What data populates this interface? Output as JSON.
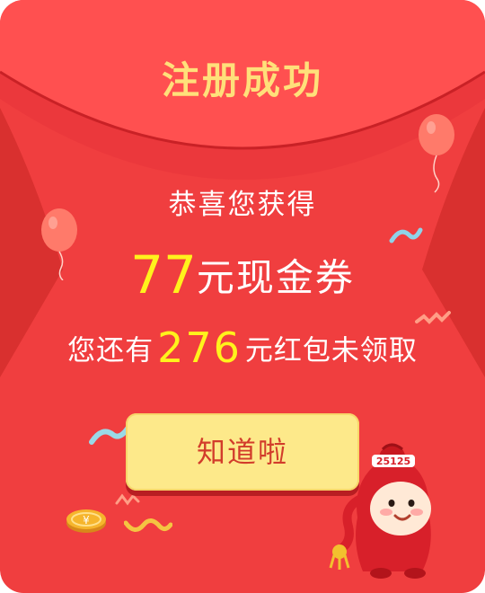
{
  "dialog": {
    "title": "注册成功",
    "subtitle": "恭喜您获得",
    "amount": {
      "number": "77",
      "unit_text": "元现金券"
    },
    "remaining": {
      "prefix": "您还有",
      "number": "276",
      "suffix": "元红包未领取"
    },
    "button_label": "知道啦",
    "mascot_badge_text": "25125"
  },
  "colors": {
    "background": "#f03e3f",
    "title": "#ffe07a",
    "highlight_number": "#fff21c",
    "button_bg": "#fde98a",
    "button_text": "#d23c2b"
  },
  "icons": [
    "balloon-icon",
    "coin-icon",
    "confetti-icon",
    "mascot-icon"
  ]
}
